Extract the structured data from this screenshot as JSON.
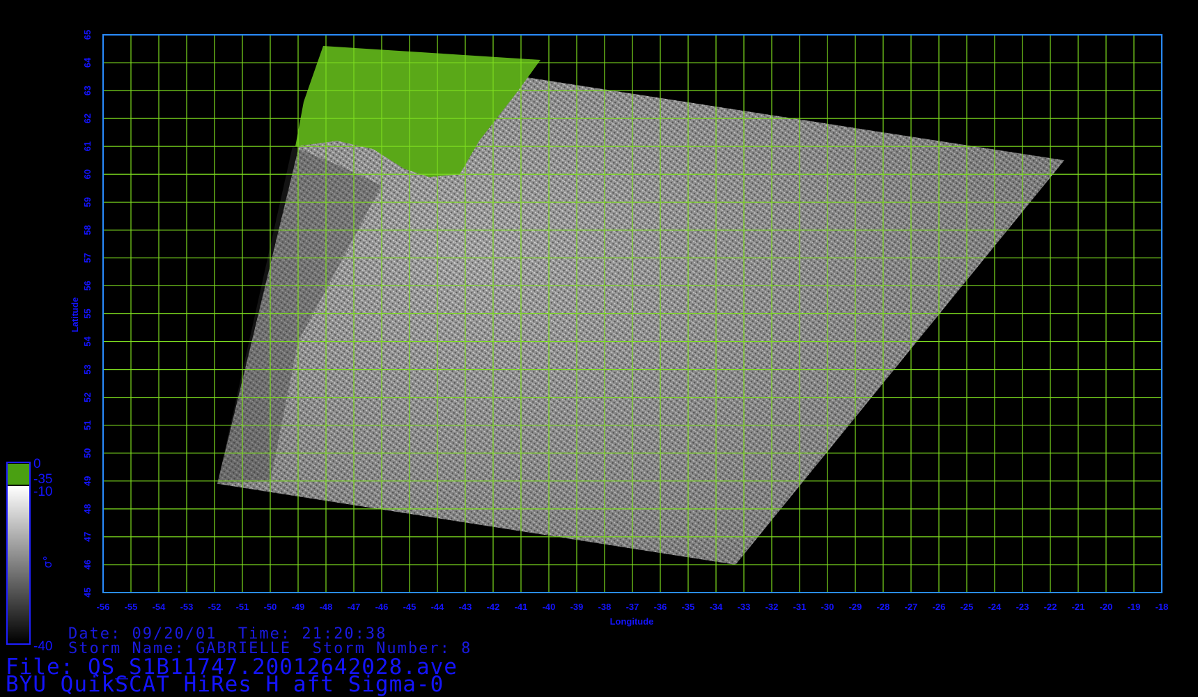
{
  "title": {
    "date_label": "Date: 09/20/01  Time: 21:20:38",
    "storm_label": "Storm Name: GABRIELLE  Storm Number: 8",
    "file_label": "File: QS_S1B11747.20012642028.ave",
    "product_label": "BYU QuikSCAT HiRes H aft Sigma-0"
  },
  "map": {
    "xlabel": "Longitude",
    "ylabel": "Latitude",
    "lon_range": [
      -56,
      -18
    ],
    "lat_range": [
      45,
      65
    ],
    "x_ticks": [
      "-56",
      "-55",
      "-54",
      "-53",
      "-52",
      "-51",
      "-50",
      "-49",
      "-48",
      "-47",
      "-46",
      "-45",
      "-44",
      "-43",
      "-42",
      "-41",
      "-40",
      "-39",
      "-38",
      "-37",
      "-36",
      "-35",
      "-34",
      "-33",
      "-32",
      "-31",
      "-30",
      "-29",
      "-28",
      "-27",
      "-26",
      "-25",
      "-24",
      "-23",
      "-22",
      "-21",
      "-20",
      "-19",
      "-18"
    ],
    "y_ticks": [
      "45",
      "46",
      "47",
      "48",
      "49",
      "50",
      "51",
      "52",
      "53",
      "54",
      "55",
      "56",
      "57",
      "58",
      "59",
      "60",
      "61",
      "62",
      "63",
      "64",
      "65"
    ],
    "grid": true,
    "grid_color": "#7ddc1f",
    "frame_color": "#2a8cff",
    "label_color": "#1414ff",
    "land_color": "#5aa818",
    "swath_corners_lonlat": [
      [
        -48.1,
        64.6
      ],
      [
        -21.5,
        60.5
      ],
      [
        -33.3,
        46.0
      ],
      [
        -51.9,
        48.9
      ]
    ]
  },
  "colorbar": {
    "label": "σ°",
    "ticks": [
      "0",
      "-35",
      "-10",
      "-40"
    ],
    "land_color": "#4aa012",
    "ramp_top": "#ffffff",
    "ramp_bottom": "#000000",
    "frame_color": "#1e1eff"
  }
}
